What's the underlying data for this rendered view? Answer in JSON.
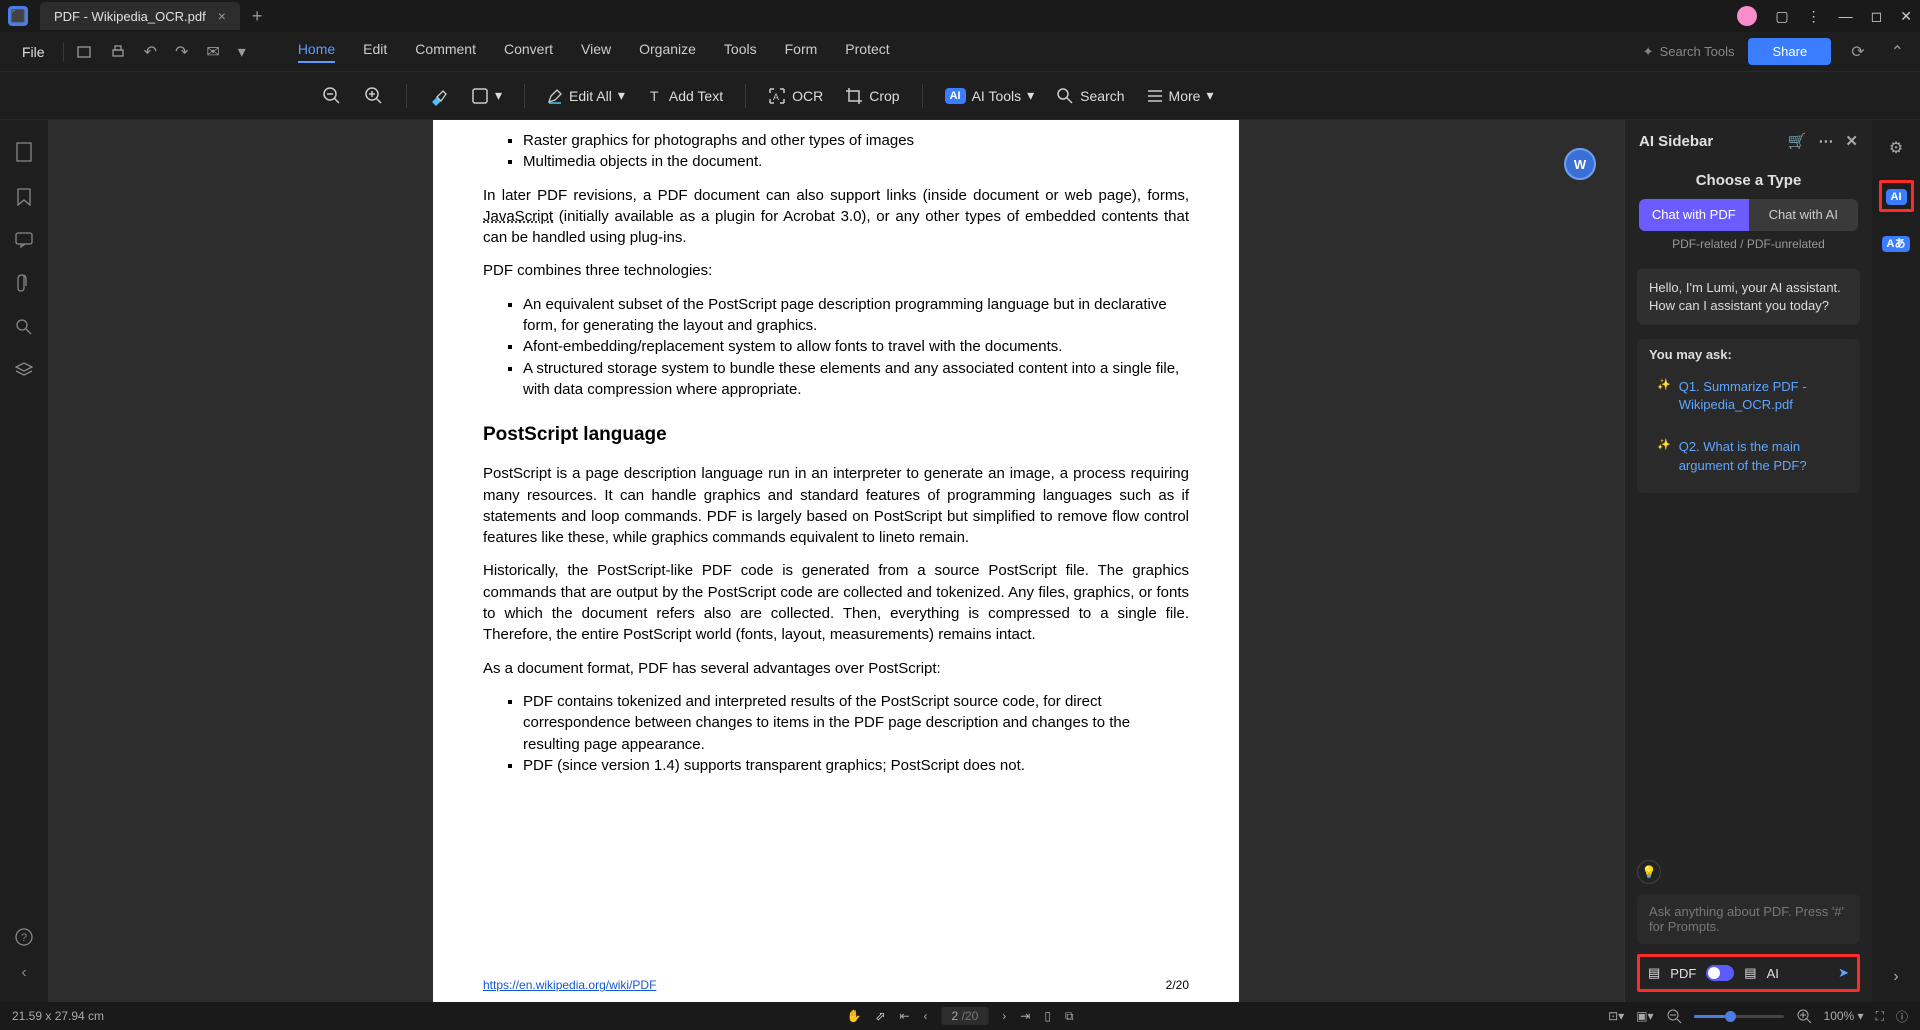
{
  "tab": {
    "name": "PDF - Wikipedia_OCR.pdf"
  },
  "file_menu": "File",
  "menu": [
    "Home",
    "Edit",
    "Comment",
    "Convert",
    "View",
    "Organize",
    "Tools",
    "Form",
    "Protect"
  ],
  "search_tools": "Search Tools",
  "share": "Share",
  "toolbar": {
    "edit_all": "Edit All",
    "add_text": "Add Text",
    "ocr": "OCR",
    "crop": "Crop",
    "ai_tools": "AI Tools",
    "search": "Search",
    "more": "More"
  },
  "doc": {
    "bullets1": [
      "Raster graphics for photographs and other types of images",
      "Multimedia objects in the document."
    ],
    "para1a": "In later PDF revisions, a PDF document can also support links (inside document or web page), forms, ",
    "para1b": " (initially available as a plugin for Acrobat 3.0), or any other types of embedded contents that can be handled using plug-ins.",
    "js": "JavaScript",
    "para2": "PDF combines three technologies:",
    "bullets2": [
      "An equivalent subset of the PostScript page description programming language but in declarative form, for generating the layout and graphics.",
      "Afont-embedding/replacement system to allow fonts to travel with the documents.",
      "A structured storage system to bundle these elements and any associated content into a single file, with data compression where appropriate."
    ],
    "heading": "PostScript language",
    "para3": "PostScript is a page description language run in an interpreter to generate an image, a process requiring many resources. It can handle graphics and standard features of programming languages such as if statements and loop commands. PDF is largely based on PostScript but simplified to remove flow control features like these, while graphics commands equivalent to lineto remain.",
    "para4": "Historically, the PostScript-like PDF code is generated from a source PostScript file. The graphics commands that are output by the PostScript code are collected and tokenized. Any files, graphics, or fonts to which the document refers also are collected. Then, everything is compressed to a single file. Therefore, the entire PostScript world (fonts, layout, measurements) remains intact.",
    "para5": "As a document format, PDF has several advantages over PostScript:",
    "bullets3": [
      "PDF contains tokenized and interpreted results of the PostScript source code, for direct correspondence between changes to items in the PDF page description and changes to the resulting page appearance.",
      "PDF (since version 1.4) supports transparent graphics; PostScript does not."
    ],
    "url": "https://en.wikipedia.org/wiki/PDF",
    "page_indicator": "2/20"
  },
  "sidebar": {
    "title": "AI Sidebar",
    "choose": "Choose a Type",
    "opt1": "Chat with PDF",
    "opt2": "Chat with AI",
    "subtitle": "PDF-related / PDF-unrelated",
    "greeting": "Hello, I'm Lumi, your AI assistant. How can I assistant you today?",
    "ask_header": "You may ask:",
    "q1": "Q1. Summarize PDF - Wikipedia_OCR.pdf",
    "q2": "Q2. What is the main argument of the PDF?",
    "placeholder": "Ask anything about PDF. Press '#' for Prompts.",
    "mode_pdf": "PDF",
    "mode_ai": "AI"
  },
  "status": {
    "dims": "21.59 x 27.94 cm",
    "page_current": "2",
    "page_total": "/20",
    "zoom": "100%"
  }
}
